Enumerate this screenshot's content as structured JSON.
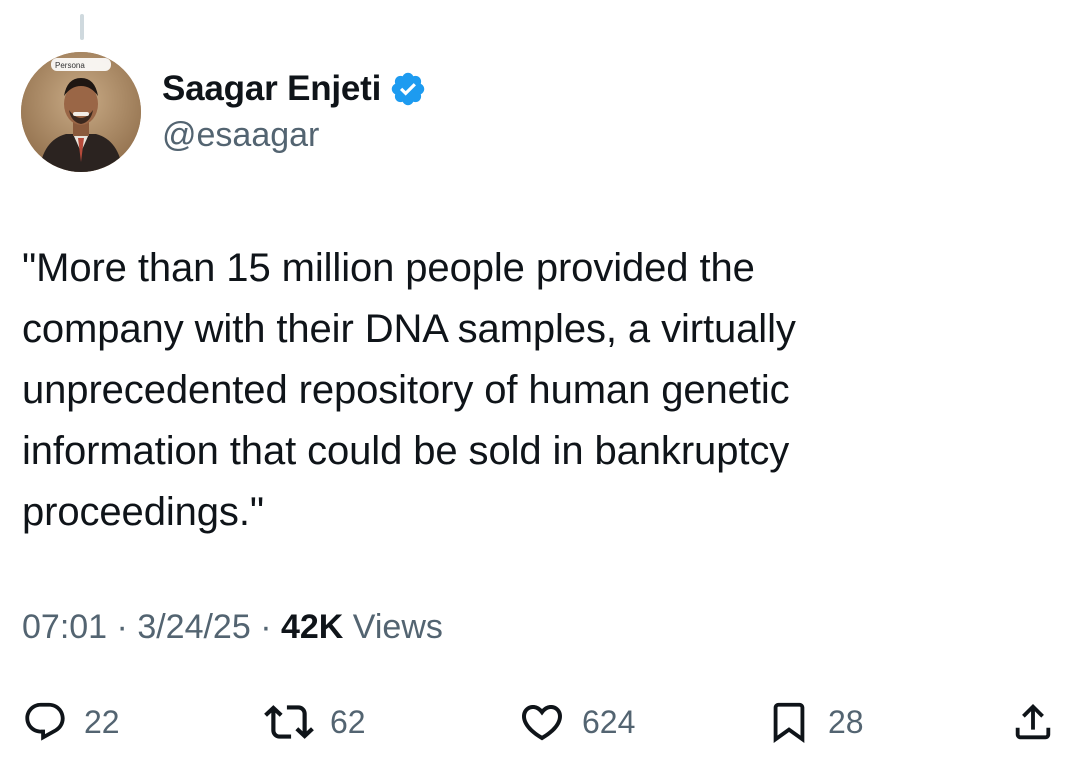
{
  "author": {
    "name": "Saagar Enjeti",
    "handle": "@esaagar",
    "verified": true,
    "avatar_badge": "Persona"
  },
  "tweet": {
    "text": "\"More than 15 million people provided the\ncompany with their DNA samples, a virtually\nunprecedented repository of human genetic\ninformation that could be sold in bankruptcy\nproceedings.\""
  },
  "meta": {
    "time": "07:01",
    "sep1": " · ",
    "date": "3/24/25",
    "sep2": " · ",
    "views_count": "42K",
    "views_label": " Views"
  },
  "actions": {
    "replies": "22",
    "reposts": "62",
    "likes": "624",
    "bookmarks": "28"
  },
  "colors": {
    "text": "#0f1419",
    "secondary": "#536471",
    "verified": "#1d9bf0"
  },
  "icons": [
    "reply-icon",
    "repost-icon",
    "like-icon",
    "bookmark-icon",
    "share-icon",
    "verified-badge-icon"
  ]
}
